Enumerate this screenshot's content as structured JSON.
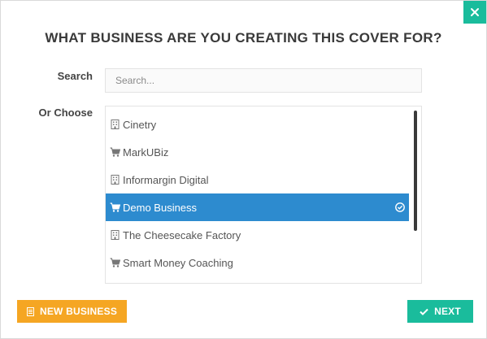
{
  "dialog": {
    "title": "WHAT BUSINESS ARE YOU CREATING THIS COVER FOR?",
    "close_icon": "close-icon"
  },
  "search": {
    "label": "Search",
    "placeholder": "Search...",
    "value": ""
  },
  "choose": {
    "label": "Or Choose",
    "items": [
      {
        "label": "Cinetry",
        "icon": "building-icon",
        "selected": false
      },
      {
        "label": "MarkUBiz",
        "icon": "cart-icon",
        "selected": false
      },
      {
        "label": "Informargin Digital",
        "icon": "building-icon",
        "selected": false
      },
      {
        "label": "Demo Business",
        "icon": "cart-icon",
        "selected": true
      },
      {
        "label": "The Cheesecake Factory",
        "icon": "building-icon",
        "selected": false
      },
      {
        "label": "Smart Money Coaching",
        "icon": "cart-icon",
        "selected": false
      }
    ]
  },
  "buttons": {
    "new_business": "NEW BUSINESS",
    "next": "NEXT"
  },
  "colors": {
    "accent_teal": "#1abc9c",
    "accent_orange": "#f5a623",
    "selected_blue": "#2d8bcf"
  }
}
